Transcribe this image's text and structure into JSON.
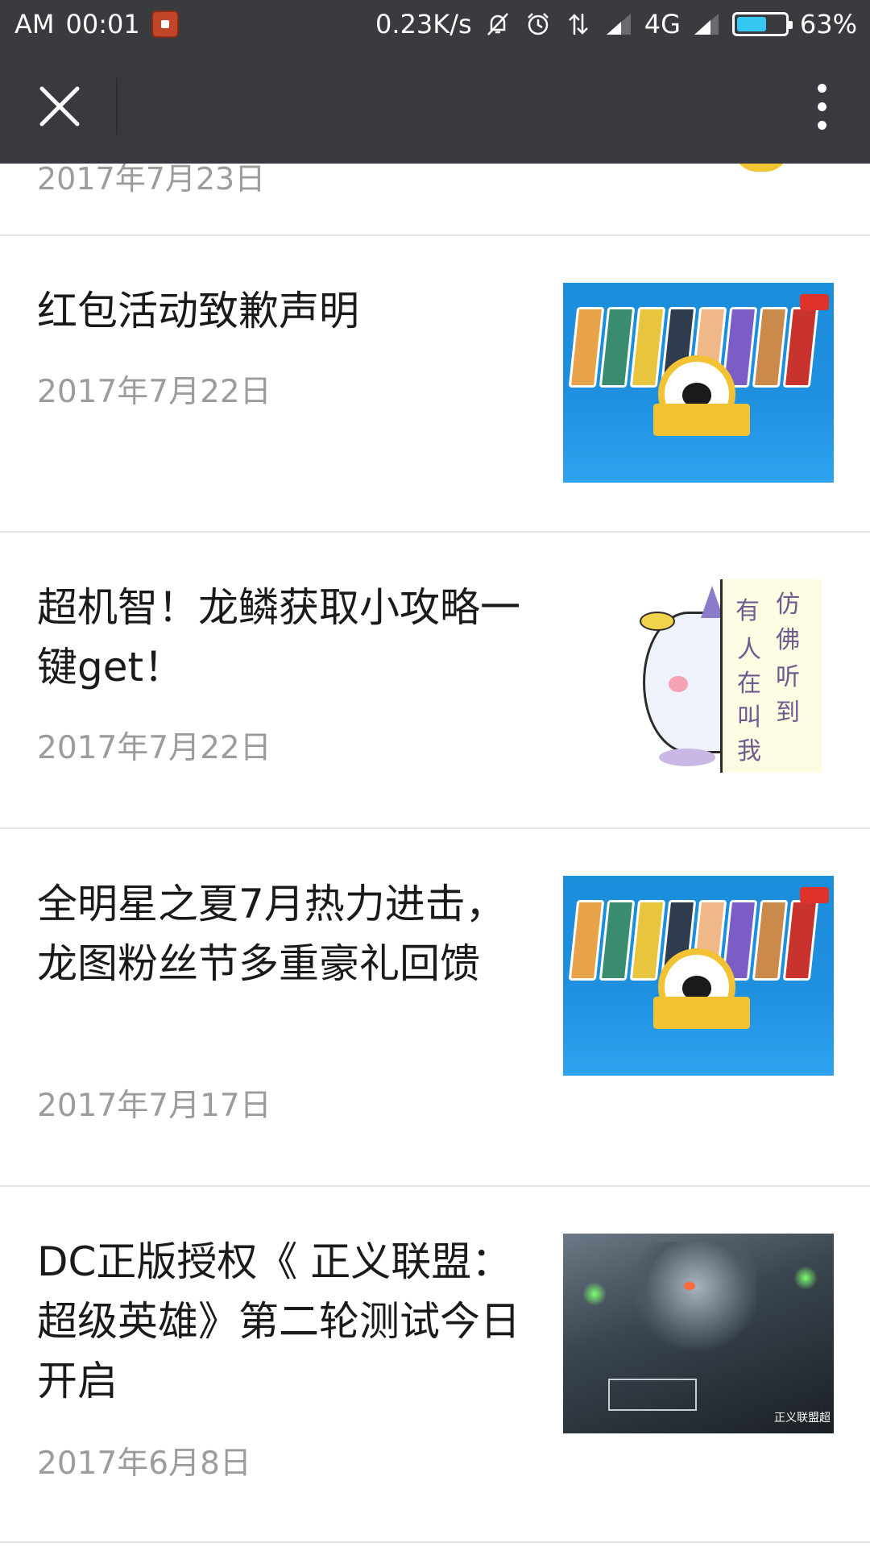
{
  "status_bar": {
    "ampm": "AM",
    "time": "00:01",
    "net_speed": "0.23K/s",
    "network_type": "4G",
    "battery_percent": "63%",
    "battery_level": 0.63
  },
  "toolbar": {
    "close_icon": "close-icon",
    "more_icon": "more-vertical-icon"
  },
  "partial_item": {
    "date": "2017年7月23日"
  },
  "articles": [
    {
      "title": "红包活动致歉声明",
      "date": "2017年7月22日",
      "thumb": "banner"
    },
    {
      "title": "超机智！龙鳞获取小攻略一键get！",
      "date": "2017年7月22日",
      "thumb": "sticker",
      "sticker_text": [
        "有",
        "仿",
        "人",
        "佛",
        "在",
        "听",
        "叫",
        "到",
        "我"
      ]
    },
    {
      "title": "全明星之夏7月热力进击，龙图粉丝节多重豪礼回馈",
      "date": "2017年7月17日",
      "thumb": "banner"
    },
    {
      "title": "DC正版授权《 正义联盟：超级英雄》第二轮测试今日开启",
      "date": "2017年6月8日",
      "thumb": "hero",
      "thumb_watermark": "正义联盟超"
    }
  ],
  "colors": {
    "status_bar_bg": "#3a3b3f",
    "toolbar_bg": "#393a3f",
    "title_text": "#1a1a1a",
    "date_text": "#9c9c9c",
    "separator": "#e5e5e5",
    "battery_fill": "#33c7f2"
  }
}
